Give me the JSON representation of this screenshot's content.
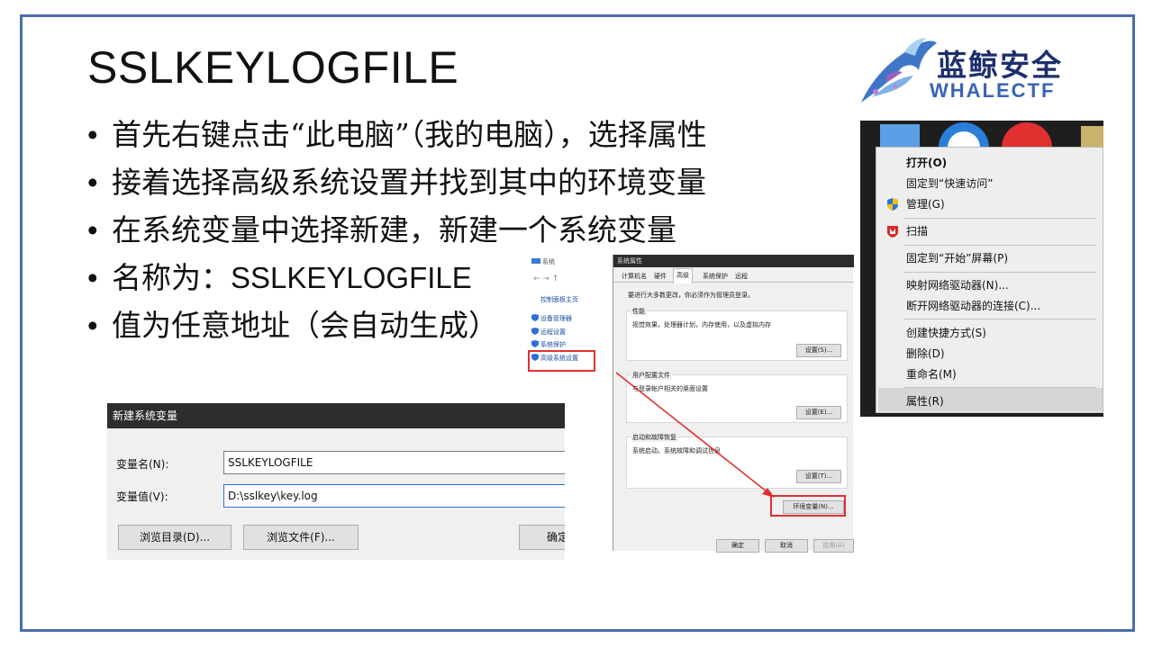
{
  "slide": {
    "title": "SSLKEYLOGFILE",
    "bullets": [
      "首先右键点击“此电脑”（我的电脑），选择属性",
      "接着选择高级系统设置并找到其中的环境变量",
      "在系统变量中选择新建，新建一个系统变量",
      "名称为：",
      "值为任意地址（会自动生成）"
    ],
    "bullet4_value": "SSLKEYLOGFILE"
  },
  "logo": {
    "cn": "蓝鲸安全",
    "en": "WHALECTF"
  },
  "context_menu": {
    "items": [
      "打开(O)",
      "固定到“快速访问”",
      "管理(G)",
      "扫描",
      "固定到“开始”屏幕(P)",
      "映射网络驱动器(N)...",
      "断开网络驱动器的连接(C)...",
      "创建快捷方式(S)",
      "删除(D)",
      "重命名(M)",
      "属性(R)"
    ]
  },
  "system_window": {
    "breadcrumb": "系统",
    "left_links": [
      "控制面板主页",
      "设备管理器",
      "远程设置",
      "系统保护",
      "高级系统设置"
    ],
    "dialog_title": "系统属性",
    "tabs": [
      "计算机名",
      "硬件",
      "高级",
      "系统保护",
      "远程"
    ],
    "admin_note": "要进行大多数更改，你必须作为管理员登录。",
    "perf_title": "性能",
    "perf_desc": "视觉效果，处理器计划，内存使用，以及虚拟内存",
    "perf_btn": "设置(S)...",
    "profile_title": "用户配置文件",
    "profile_desc": "与登录帐户相关的桌面设置",
    "profile_btn": "设置(E)...",
    "startup_title": "启动和故障恢复",
    "startup_desc": "系统启动、系统故障和调试信息",
    "startup_btn": "设置(T)...",
    "env_btn": "环境变量(N)...",
    "ok": "确定",
    "cancel": "取消",
    "apply": "应用(A)"
  },
  "new_var_dialog": {
    "title": "新建系统变量",
    "name_label": "变量名(N):",
    "name_value": "SSLKEYLOGFILE",
    "value_label": "变量值(V):",
    "value_value": "D:\\sslkey\\key.log",
    "browse_dir": "浏览目录(D)...",
    "browse_file": "浏览文件(F)...",
    "ok": "确定"
  }
}
